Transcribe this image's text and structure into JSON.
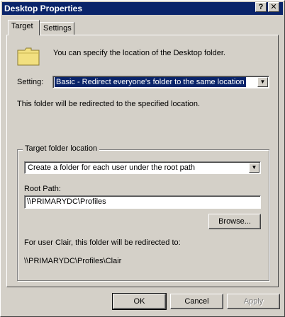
{
  "window": {
    "title": "Desktop Properties",
    "help_label": "?",
    "close_label": "✕"
  },
  "tabs": [
    {
      "label": "Target",
      "active": true
    },
    {
      "label": "Settings",
      "active": false
    }
  ],
  "target": {
    "description": "You can specify the location of the Desktop folder.",
    "setting_label": "Setting:",
    "setting_value": "Basic - Redirect everyone's folder to the same location",
    "redirect_info": "This folder will be redirected to the specified location.",
    "group_title": "Target folder location",
    "location_option": "Create a folder for each user under the root path",
    "root_path_label": "Root Path:",
    "root_path_value": "\\\\PRIMARYDC\\Profiles",
    "browse_label": "Browse...",
    "preview_caption": "For user Clair, this folder will be redirected to:",
    "preview_path": "\\\\PRIMARYDC\\Profiles\\Clair"
  },
  "footer": {
    "ok_label": "OK",
    "cancel_label": "Cancel",
    "apply_label": "Apply"
  },
  "icons": {
    "folder": "folder-icon",
    "dropdown": "chevron-down-icon"
  },
  "colors": {
    "titlebar": "#0a246a",
    "face": "#d4d0c8",
    "folder": "#f2e080"
  }
}
